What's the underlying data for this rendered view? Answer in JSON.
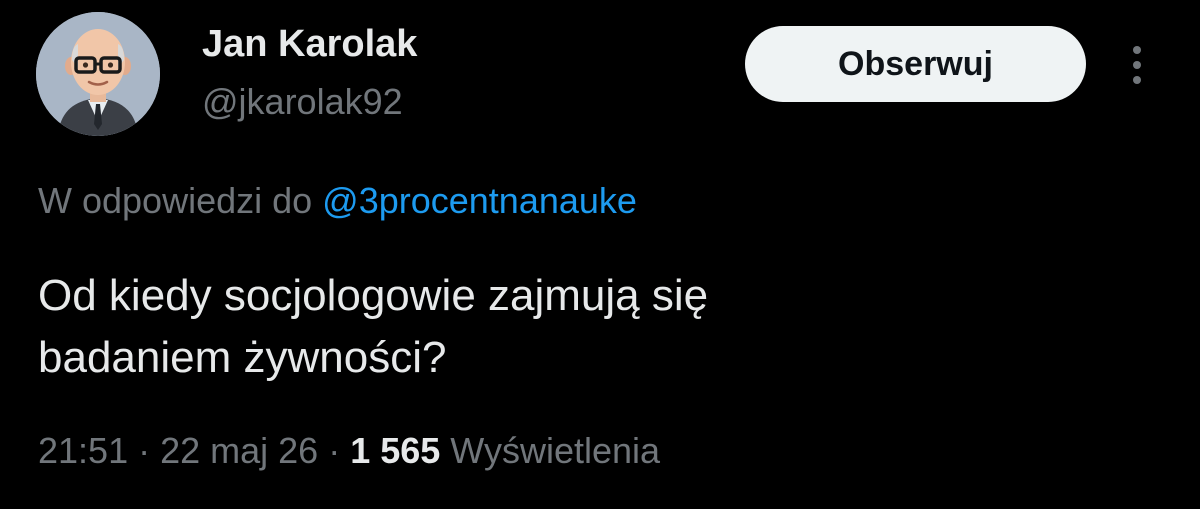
{
  "author": {
    "name": "Jan Karolak",
    "handle": "@jkarolak92",
    "avatar_icon": "cartoon-man-glasses-avatar"
  },
  "header": {
    "follow_label": "Obserwuj",
    "more_icon": "vertical-ellipsis-icon"
  },
  "reply": {
    "prefix": "W odpowiedzi do ",
    "mention": "@3procentnanauke"
  },
  "tweet": {
    "lines": [
      "Od kiedy socjologowie zajmują się",
      "badaniem żywności?"
    ]
  },
  "meta": {
    "time": "21:51",
    "separator": " · ",
    "date": "22 maj 26",
    "views_count": "1 565",
    "views_label": " Wyświetlenia"
  },
  "colors": {
    "background": "#000000",
    "primary_text": "#e7e9ea",
    "secondary_text": "#71767b",
    "link": "#1d9bf0",
    "button_bg": "#eff3f4",
    "button_text": "#0f1419"
  }
}
